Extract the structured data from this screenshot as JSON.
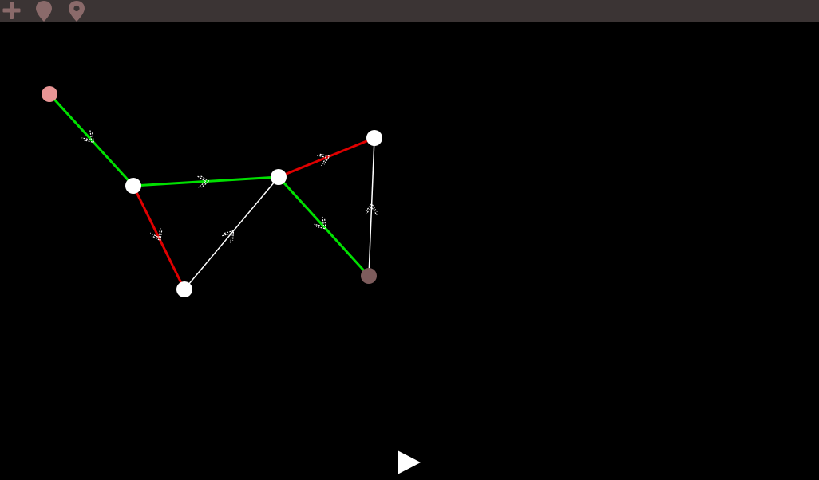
{
  "toolbar": {
    "tools": [
      {
        "icon": "add-node-icon",
        "color": "#8a6a6a"
      },
      {
        "icon": "map-pin-filled-icon",
        "color": "#8a6a6a"
      },
      {
        "icon": "map-pin-outline-icon",
        "color": "#8a6a6a"
      }
    ]
  },
  "graph": {
    "colors": {
      "background": "#000000",
      "node_default": "#ffffff",
      "node_start": "#e89595",
      "node_end": "#7d5c5c",
      "edge_green": "#00e000",
      "edge_red": "#e00000",
      "edge_white": "#ffffff"
    },
    "nodes": [
      {
        "id": "n1",
        "role": "start"
      },
      {
        "id": "n2",
        "role": "default"
      },
      {
        "id": "n3",
        "role": "default"
      },
      {
        "id": "n4",
        "role": "default"
      },
      {
        "id": "n5",
        "role": "default"
      },
      {
        "id": "n6",
        "role": "end"
      }
    ],
    "edges": [
      {
        "from": "n1",
        "to": "n2",
        "state": "green"
      },
      {
        "from": "n2",
        "to": "n4",
        "state": "green"
      },
      {
        "from": "n2",
        "to": "n3",
        "state": "red"
      },
      {
        "from": "n3",
        "to": "n4",
        "state": "white"
      },
      {
        "from": "n4",
        "to": "n5",
        "state": "red"
      },
      {
        "from": "n4",
        "to": "n6",
        "state": "green"
      },
      {
        "from": "n6",
        "to": "n5",
        "state": "white"
      }
    ]
  },
  "controls": {
    "play_icon": "play-icon"
  }
}
